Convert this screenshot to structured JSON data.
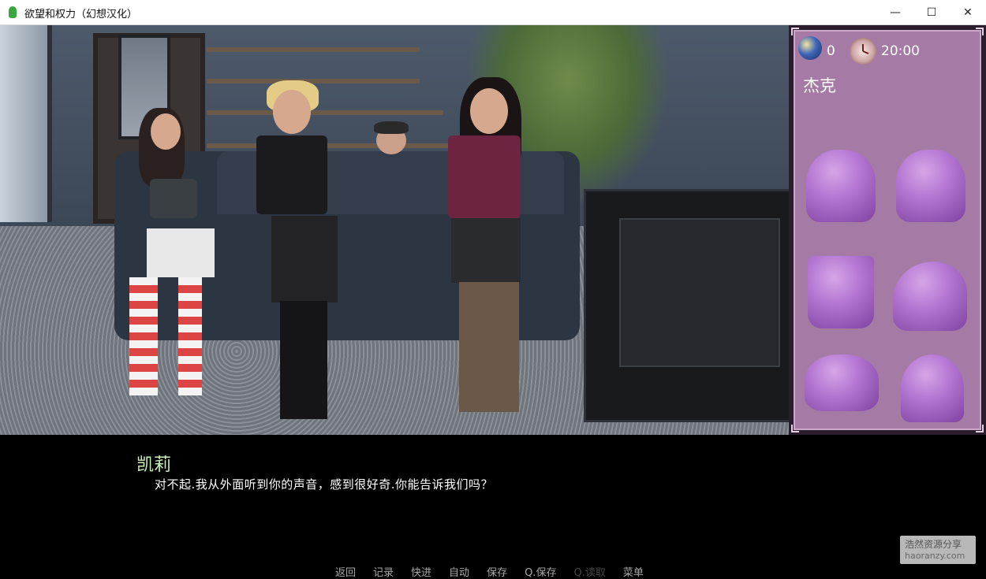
{
  "window": {
    "title": "欲望和权力（幻想汉化）",
    "controls": {
      "minimize": "—",
      "maximize": "☐",
      "close": "✕"
    }
  },
  "panel": {
    "time_icon": "clock-icon",
    "day_icon": "moon-sun-icon",
    "counter": "0",
    "time": "20:00",
    "character_name": "杰克",
    "locked_portraits": 6
  },
  "dialogue": {
    "speaker": "凯莉",
    "text": "对不起.我从外面听到你的声音，感到很好奇.你能告诉我们吗？"
  },
  "quick_menu": [
    {
      "label": "返回",
      "enabled": true
    },
    {
      "label": "记录",
      "enabled": true
    },
    {
      "label": "快进",
      "enabled": true
    },
    {
      "label": "自动",
      "enabled": true
    },
    {
      "label": "保存",
      "enabled": true
    },
    {
      "label": "Q.保存",
      "enabled": true
    },
    {
      "label": "Q.读取",
      "enabled": false
    },
    {
      "label": "菜单",
      "enabled": true
    }
  ],
  "watermark": {
    "line1": "浩然资源分享",
    "line2": "haoranzy.com"
  },
  "colors": {
    "speaker_name": "#c8f0b8",
    "panel_bg": "#a57aa4",
    "silhouette": "#b577d6"
  }
}
